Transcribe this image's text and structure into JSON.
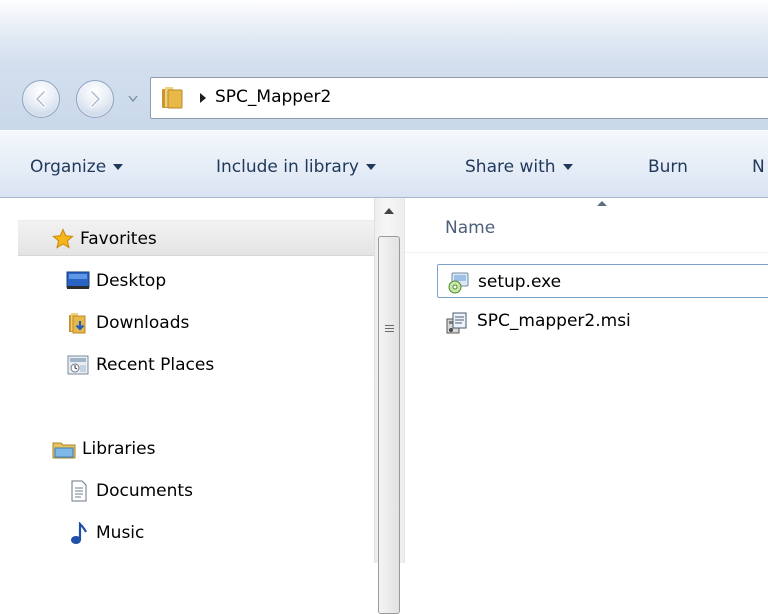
{
  "address": {
    "path_segment": "SPC_Mapper2"
  },
  "toolbar": {
    "organize": "Organize",
    "include_in_library": "Include in library",
    "share_with": "Share with",
    "burn": "Burn",
    "new_folder_partial": "N"
  },
  "nav": {
    "favorites": {
      "label": "Favorites",
      "items": [
        "Desktop",
        "Downloads",
        "Recent Places"
      ]
    },
    "libraries": {
      "label": "Libraries",
      "items": [
        "Documents",
        "Music"
      ]
    }
  },
  "content": {
    "column_name": "Name",
    "sort_direction": "ascending",
    "files": [
      {
        "name": "setup.exe",
        "icon": "setup-exe-icon"
      },
      {
        "name": "SPC_mapper2.msi",
        "icon": "msi-installer-icon"
      }
    ]
  },
  "colors": {
    "toolbar_text": "#1e395b",
    "selection_border": "#7da2ce",
    "folder": "#e8b848",
    "star": "#f5b400"
  }
}
